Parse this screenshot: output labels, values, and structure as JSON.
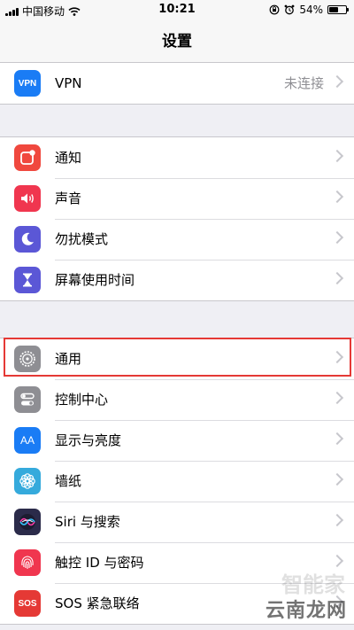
{
  "status_bar": {
    "carrier": "中国移动",
    "time": "10:21",
    "battery_text": "54%",
    "battery_level": 0.54,
    "icons": [
      "signal-icon",
      "wifi-icon",
      "orientation-lock-icon",
      "alarm-icon",
      "battery-icon"
    ]
  },
  "navbar": {
    "title": "设置"
  },
  "group_vpn": {
    "items": [
      {
        "label": "VPN",
        "value": "未连接",
        "icon": "vpn-icon",
        "icon_text": "VPN",
        "color": "#1a7cf5"
      }
    ]
  },
  "group_notify": {
    "items": [
      {
        "label": "通知",
        "icon": "notifications-icon",
        "color": "#f0483e"
      },
      {
        "label": "声音",
        "icon": "sounds-icon",
        "color": "#f0364f"
      },
      {
        "label": "勿扰模式",
        "icon": "do-not-disturb-icon",
        "color": "#5b57d6"
      },
      {
        "label": "屏幕使用时间",
        "icon": "screen-time-icon",
        "color": "#5b57d6"
      }
    ]
  },
  "group_general": {
    "items": [
      {
        "label": "通用",
        "icon": "gear-icon",
        "color": "#8e8e93",
        "highlighted": true
      },
      {
        "label": "控制中心",
        "icon": "control-center-icon",
        "color": "#8e8e93"
      },
      {
        "label": "显示与亮度",
        "icon": "display-brightness-icon",
        "icon_text": "AA",
        "color": "#1a7cf5"
      },
      {
        "label": "墙纸",
        "icon": "wallpaper-icon",
        "color": "#35aadc"
      },
      {
        "label": "Siri 与搜索",
        "icon": "siri-icon",
        "color": "#2b2b4a"
      },
      {
        "label": "触控 ID 与密码",
        "icon": "touch-id-icon",
        "color": "#f0364f"
      },
      {
        "label": "SOS 紧急联络",
        "icon": "sos-icon",
        "icon_text": "SOS",
        "color": "#e53935"
      }
    ]
  },
  "watermark": {
    "brand": "云南龙网",
    "faint": "智能家"
  }
}
